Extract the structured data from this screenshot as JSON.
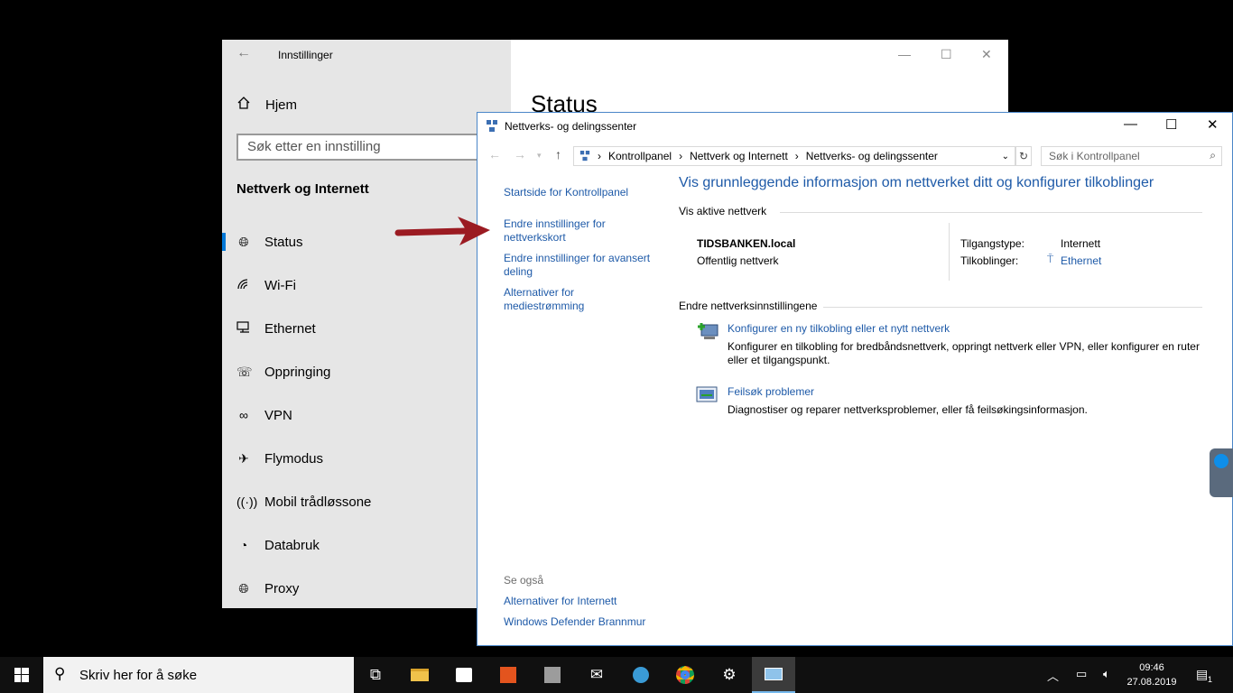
{
  "settings": {
    "title": "Innstillinger",
    "home": "Hjem",
    "search_placeholder": "Søk etter en innstilling",
    "section": "Nettverk og Internett",
    "content_title": "Status",
    "nav": [
      {
        "label": "Status",
        "icon": "globe-icon",
        "active": true
      },
      {
        "label": "Wi-Fi",
        "icon": "wifi-icon"
      },
      {
        "label": "Ethernet",
        "icon": "ethernet-icon"
      },
      {
        "label": "Oppringing",
        "icon": "dialup-icon"
      },
      {
        "label": "VPN",
        "icon": "vpn-icon"
      },
      {
        "label": "Flymodus",
        "icon": "airplane-icon"
      },
      {
        "label": "Mobil trådløssone",
        "icon": "hotspot-icon"
      },
      {
        "label": "Databruk",
        "icon": "data-usage-icon"
      },
      {
        "label": "Proxy",
        "icon": "globe-icon"
      }
    ]
  },
  "cp": {
    "title": "Nettverks- og delingssenter",
    "breadcrumb": [
      "Kontrollpanel",
      "Nettverk og Internett",
      "Nettverks- og delingssenter"
    ],
    "search_placeholder": "Søk i Kontrollpanel",
    "left_links": [
      "Startside for Kontrollpanel",
      "Endre innstillinger for nettverkskort",
      "Endre innstillinger for avansert deling",
      "Alternativer for mediestrømming"
    ],
    "see_also": "Se også",
    "see_also_links": [
      "Alternativer for Internett",
      "Windows Defender Brannmur"
    ],
    "heading": "Vis grunnleggende informasjon om nettverket ditt og konfigurer tilkoblinger",
    "active_networks": "Vis aktive nettverk",
    "network_name": "TIDSBANKEN.local",
    "network_type": "Offentlig nettverk",
    "access_type_label": "Tilgangstype:",
    "access_type_value": "Internett",
    "connections_label": "Tilkoblinger:",
    "connections_value": "Ethernet",
    "change_settings": "Endre nettverksinnstillingene",
    "task1_link": "Konfigurer en ny tilkobling eller et nytt nettverk",
    "task1_desc": "Konfigurer en tilkobling for bredbåndsnettverk, oppringt nettverk eller VPN, eller konfigurer en ruter eller et tilgangspunkt.",
    "task2_link": "Feilsøk problemer",
    "task2_desc": "Diagnostiser og reparer nettverksproblemer, eller få feilsøkingsinformasjon."
  },
  "taskbar": {
    "search_placeholder": "Skriv her for å søke",
    "time": "09:46",
    "date": "27.08.2019",
    "notification_count": "1"
  },
  "colors": {
    "accent": "#0078d7",
    "link": "#1e5aa8",
    "arrow": "#9b1b22"
  }
}
